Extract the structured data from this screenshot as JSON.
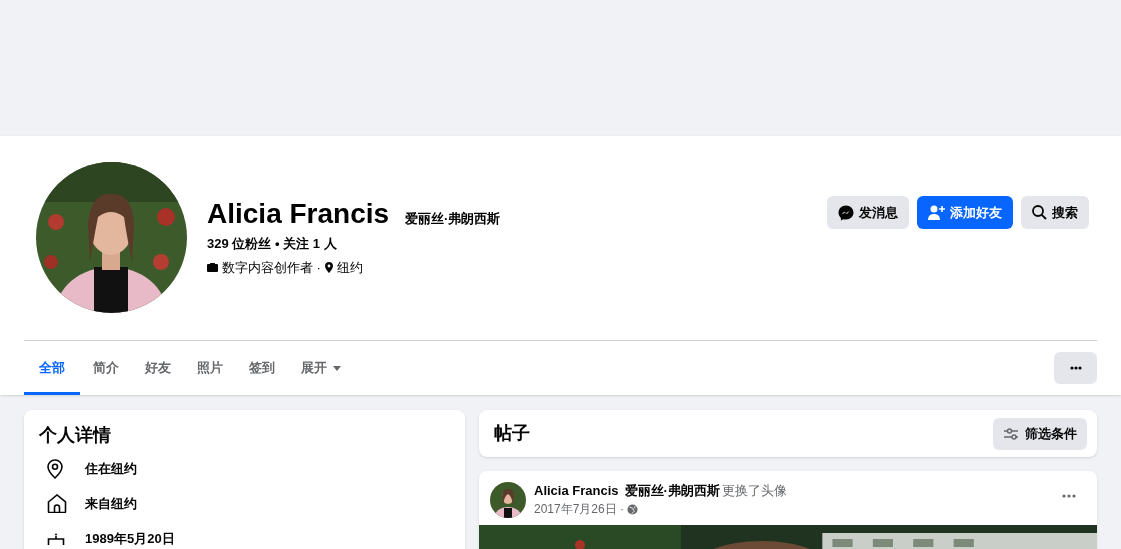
{
  "profile": {
    "name": "Alicia Francis",
    "alt_name": "爱丽丝·弗朗西斯",
    "stats": "329 位粉丝 • 关注 1 人",
    "meta": [
      {
        "kind": "category",
        "text": "数字内容创作者 ·"
      },
      {
        "kind": "location",
        "text": "纽约"
      }
    ]
  },
  "actions": [
    {
      "kind": "message",
      "label": "发消息",
      "primary": false
    },
    {
      "kind": "add_friend",
      "label": "添加好友",
      "primary": true
    },
    {
      "kind": "search",
      "label": "搜索",
      "primary": false
    }
  ],
  "tabs": [
    {
      "label": "全部",
      "selected": true,
      "kind": "tab"
    },
    {
      "label": "简介",
      "selected": false,
      "kind": "tab"
    },
    {
      "label": "好友",
      "selected": false,
      "kind": "tab"
    },
    {
      "label": "照片",
      "selected": false,
      "kind": "tab"
    },
    {
      "label": "签到",
      "selected": false,
      "kind": "tab"
    },
    {
      "label": "展开",
      "selected": false,
      "kind": "dropdown"
    }
  ],
  "intro": {
    "title": "个人详情",
    "items": [
      {
        "kind": "location",
        "text": "住在纽约"
      },
      {
        "kind": "home",
        "text": "来自纽约"
      },
      {
        "kind": "birthday",
        "text": "1989年5月20日"
      }
    ]
  },
  "posts": {
    "title": "帖子",
    "filter_button": "筛选条件"
  },
  "post": {
    "author": "Alicia Francis",
    "alt_name": "爱丽丝·弗朗西斯",
    "action": "更换了头像",
    "date": "2017年7月26日 ·",
    "public": true
  }
}
